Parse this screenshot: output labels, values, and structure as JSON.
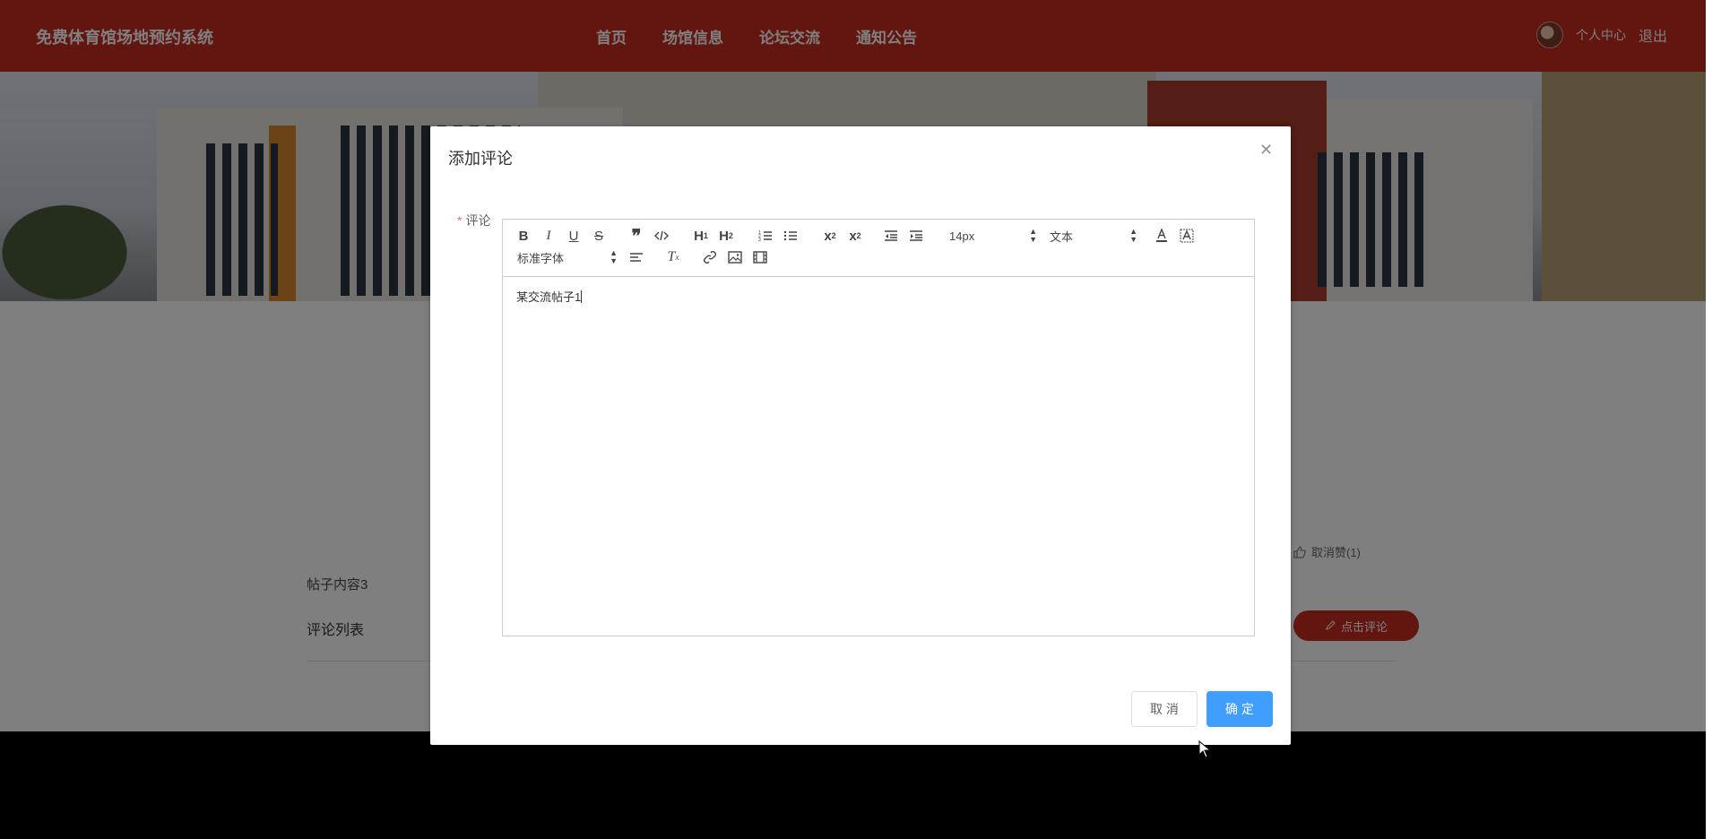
{
  "header": {
    "site_title": "免费体育馆场地预约系统",
    "nav": [
      "首页",
      "场馆信息",
      "论坛交流",
      "通知公告"
    ],
    "user_center": "个人中心",
    "logout": "退出"
  },
  "page": {
    "like_label": "取消赞(1)",
    "post_content": "帖子内容3",
    "comment_list_title": "评论列表",
    "comment_button": "点击评论"
  },
  "modal": {
    "title": "添加评论",
    "field_label": "评论",
    "editor": {
      "font_size_select": "14px",
      "header_select": "文本",
      "font_family_select": "标准字体",
      "content": "某交流帖子1"
    },
    "cancel_label": "取 消",
    "confirm_label": "确 定"
  },
  "colors": {
    "header_bg": "#c62a20",
    "primary_button": "#409eff",
    "required_star": "#f56c6c"
  }
}
